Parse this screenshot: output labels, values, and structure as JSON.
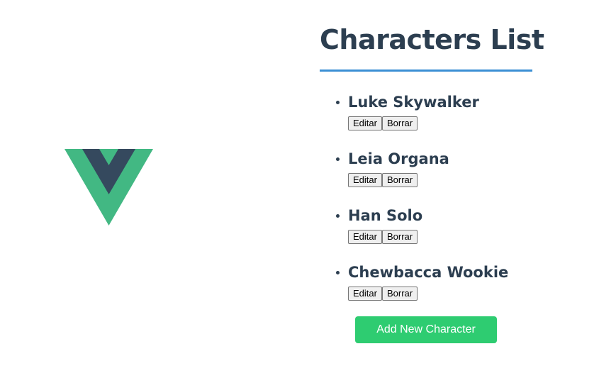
{
  "header": {
    "title": "Characters List"
  },
  "logo": {
    "icon": "vue-logo-icon",
    "colors": {
      "outer": "#42b883",
      "inner": "#35495e"
    }
  },
  "characters": [
    {
      "name": "Luke Skywalker",
      "edit_label": "Editar",
      "delete_label": "Borrar"
    },
    {
      "name": "Leia Organa",
      "edit_label": "Editar",
      "delete_label": "Borrar"
    },
    {
      "name": "Han Solo",
      "edit_label": "Editar",
      "delete_label": "Borrar"
    },
    {
      "name": "Chewbacca Wookie",
      "edit_label": "Editar",
      "delete_label": "Borrar"
    }
  ],
  "actions": {
    "add_label": "Add New Character"
  },
  "colors": {
    "text": "#2c3e50",
    "accent_underline": "#3b8fd4",
    "add_button": "#2ecc71"
  }
}
